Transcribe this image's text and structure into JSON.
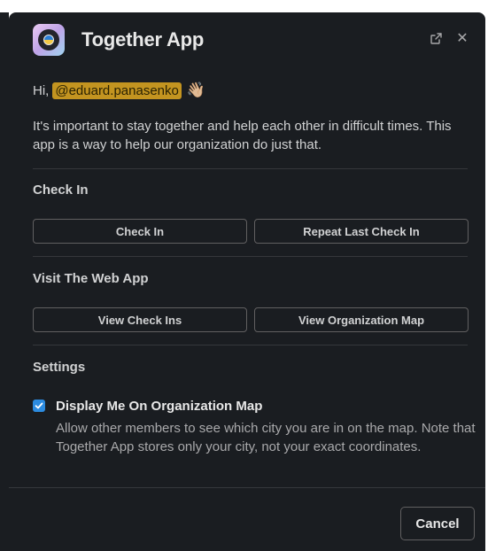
{
  "header": {
    "title": "Together App",
    "icon": "together-app-logo",
    "open_icon": "external-link-icon",
    "close_icon": "close-icon",
    "close_glyph": "✕"
  },
  "greeting": {
    "prefix": "Hi,",
    "mention": "@eduard.panasenko",
    "emoji": "👋🏼"
  },
  "intro": "It's important to stay together and help each other in difficult times. This app is a way to help our organization do just that.",
  "check_in": {
    "title": "Check In",
    "check_in_label": "Check In",
    "repeat_label": "Repeat Last Check In"
  },
  "web_app": {
    "title": "Visit The Web App",
    "view_check_ins_label": "View Check Ins",
    "view_map_label": "View Organization Map"
  },
  "settings": {
    "title": "Settings",
    "display_on_map": {
      "checked": true,
      "label": "Display Me On Organization Map",
      "description": "Allow other members to see which city you are in on the map. Note that Together App stores only your city, not your exact coordinates."
    }
  },
  "footer": {
    "cancel_label": "Cancel"
  },
  "colors": {
    "background": "#1a1d21",
    "mention_bg": "#c39420",
    "checkbox": "#2c8be0",
    "border": "#616061"
  }
}
